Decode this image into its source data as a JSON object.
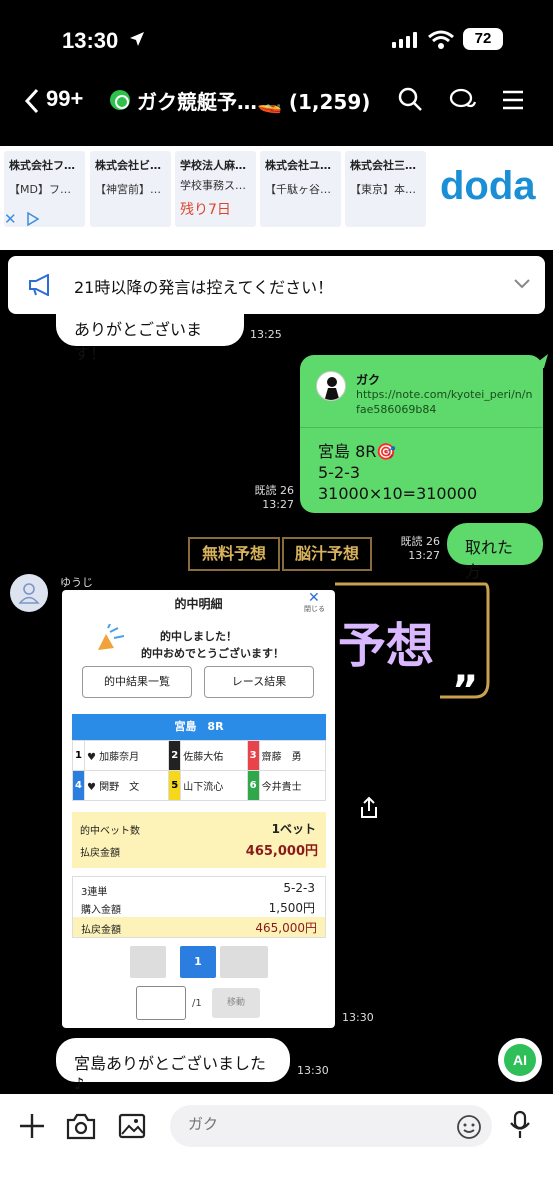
{
  "status_bar": {
    "time": "13:30",
    "battery": "72"
  },
  "header": {
    "back_count": "99+",
    "title": "ガク競艇予…🚤 (1,259)"
  },
  "ads": {
    "items": [
      {
        "company": "株式会社フ…",
        "sub": "【MD】フ…"
      },
      {
        "company": "株式会社ビ…",
        "sub": "【神宮前】…"
      },
      {
        "company": "学校法人麻…",
        "sub": "学校事務ス…",
        "highlight": "残り7日"
      },
      {
        "company": "株式会社ユ…",
        "sub": "【千駄ヶ谷…"
      },
      {
        "company": "株式会社三…",
        "sub": "【東京】本…"
      }
    ],
    "brand": "doda"
  },
  "announcement": {
    "text": "21時以降の発言は控えてください！"
  },
  "messages": {
    "m1": {
      "text": "ありがとございます！",
      "time": "13:25"
    },
    "share": {
      "sender": "ガク",
      "url": "https://note.com/kyotei_peri/n/nfae586069b84",
      "body": "宮島 8R🎯\n5-2-3\n31000×10=310000",
      "read": "既読 26",
      "time": "13:27"
    },
    "m3": {
      "text": "取れた方",
      "read": "既読 26",
      "time": "13:27"
    },
    "yuji": {
      "name": "ゆうじ",
      "time": "13:30"
    },
    "m5": {
      "text": "宮島ありがとございました♪",
      "time": "13:30"
    }
  },
  "background": {
    "box1": "無料予想",
    "box2": "脳汁予想",
    "big": "予想"
  },
  "screenshot": {
    "title": "的中明細",
    "close": "✕",
    "close_label": "閉じる",
    "hit_line1": "的中しました！",
    "hit_line2": "的中おめでとうございます！",
    "btn_list": "的中結果一覧",
    "btn_race": "レース結果",
    "race": "宮島　8R",
    "racers": [
      {
        "no": "1",
        "name": "♥ 加藤奈月",
        "color": "#ffffff",
        "fg": "#000000"
      },
      {
        "no": "2",
        "name": "佐藤大佑",
        "color": "#222222",
        "fg": "#ffffff"
      },
      {
        "no": "3",
        "name": "齋藤　勇",
        "color": "#e8424a",
        "fg": "#ffffff"
      },
      {
        "no": "4",
        "name": "♥ 関野　文",
        "color": "#2b7de0",
        "fg": "#ffffff"
      },
      {
        "no": "5",
        "name": "山下流心",
        "color": "#f5d81c",
        "fg": "#000000"
      },
      {
        "no": "6",
        "name": "今井貴士",
        "color": "#2ea84a",
        "fg": "#ffffff"
      }
    ],
    "hit_bets_label": "的中ベット数",
    "hit_bets_value": "1ベット",
    "payout_label": "払戻金額",
    "payout_value": "465,000円",
    "bet_type": "3連単",
    "bet_combo": "5-2-3",
    "purchase_label": "購入金額",
    "purchase_value": "1,500円",
    "payout2_label": "払戻金額",
    "payout2_value": "465,000円",
    "page_current": "1",
    "page_total": "/1",
    "move_label": "移動"
  },
  "input": {
    "placeholder": "ガク"
  },
  "ai_label": "AI"
}
